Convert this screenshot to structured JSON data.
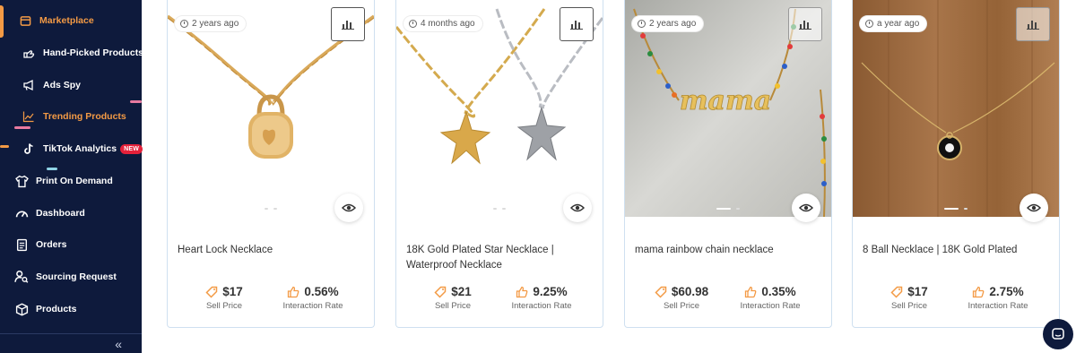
{
  "sidebar": {
    "items": [
      {
        "label": "Marketplace",
        "icon": "store-icon",
        "active": true
      },
      {
        "label": "Hand-Picked Products",
        "icon": "hand-picked-icon"
      },
      {
        "label": "Ads Spy",
        "icon": "megaphone-icon"
      },
      {
        "label": "Trending Products",
        "icon": "trend-chart-icon",
        "active": true
      },
      {
        "label": "TikTok Analytics",
        "icon": "tiktok-icon",
        "badge": "NEW"
      },
      {
        "label": "Print On Demand",
        "icon": "tshirt-icon"
      },
      {
        "label": "Dashboard",
        "icon": "gauge-icon"
      },
      {
        "label": "Orders",
        "icon": "clipboard-icon"
      },
      {
        "label": "Sourcing Request",
        "icon": "user-search-icon"
      },
      {
        "label": "Products",
        "icon": "box-icon"
      }
    ],
    "collapse_label": "«",
    "accent_color": "#f39a45",
    "background_color": "#0e1a3c"
  },
  "products": [
    {
      "age": "2 years ago",
      "title": "Heart Lock Necklace",
      "price": "$17",
      "price_label": "Sell Price",
      "rate": "0.56%",
      "rate_label": "Interaction Rate"
    },
    {
      "age": "4 months ago",
      "title": "18K Gold Plated Star Necklace | Waterproof Necklace",
      "price": "$21",
      "price_label": "Sell Price",
      "rate": "9.25%",
      "rate_label": "Interaction Rate"
    },
    {
      "age": "2 years ago",
      "title": "mama rainbow chain necklace",
      "price": "$60.98",
      "price_label": "Sell Price",
      "rate": "0.35%",
      "rate_label": "Interaction Rate"
    },
    {
      "age": "a year ago",
      "title": "8 Ball Necklace | 18K Gold Plated",
      "price": "$17",
      "price_label": "Sell Price",
      "rate": "2.75%",
      "rate_label": "Interaction Rate"
    }
  ],
  "image_text": {
    "mama_script": "mama"
  },
  "icons": {
    "stats": "bar-chart-icon",
    "preview": "eye-icon",
    "price": "tag-icon",
    "rate": "thumbs-up-icon",
    "chat": "chat-icon"
  },
  "colors": {
    "price_icon": "#f39a45",
    "card_border": "#cfe0f0"
  }
}
